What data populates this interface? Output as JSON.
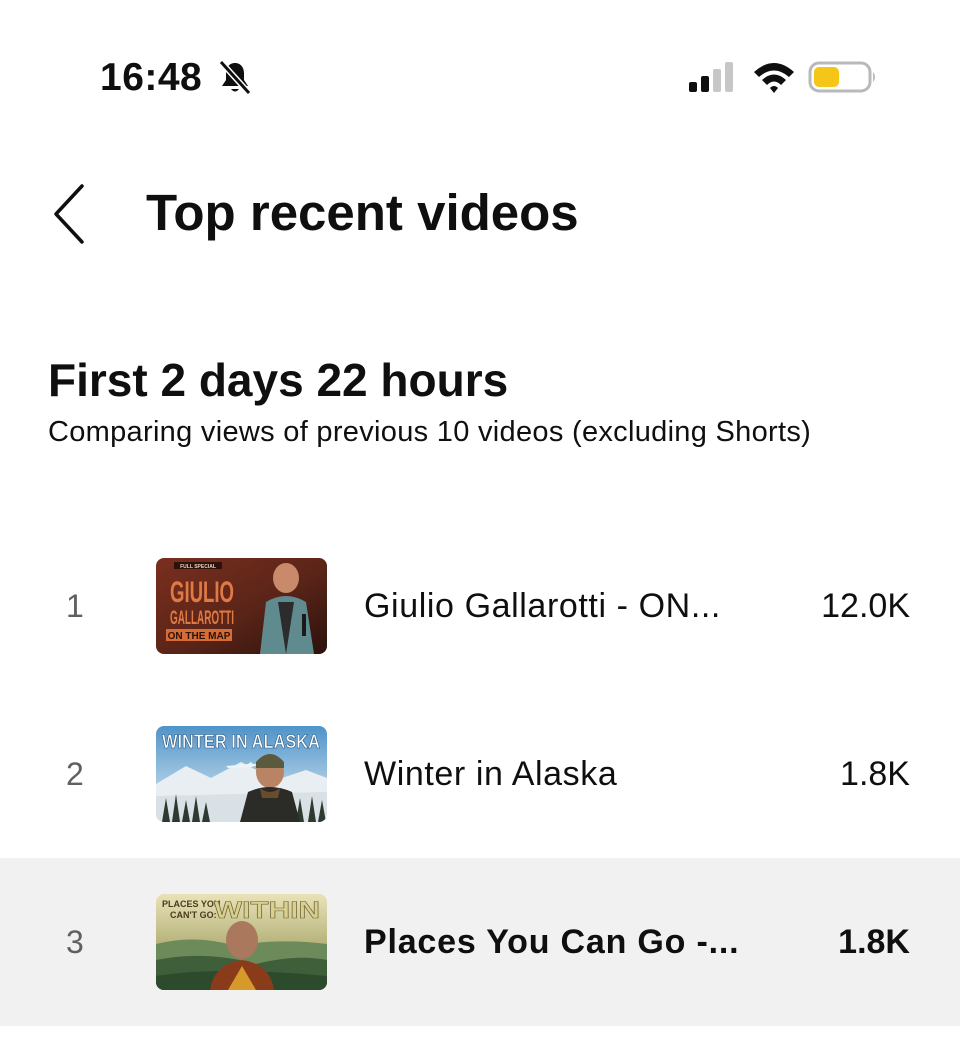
{
  "status_bar": {
    "time": "16:48",
    "icons": [
      "bell-off-icon",
      "cellular-signal-icon",
      "wifi-icon",
      "battery-low-power-icon"
    ],
    "battery_color": "#f5c518"
  },
  "header": {
    "title": "Top recent videos",
    "back_icon": "chevron-left-icon"
  },
  "section": {
    "title": "First 2 days 22 hours",
    "subtitle": "Comparing views of previous 10 videos (excluding Shorts)"
  },
  "videos": [
    {
      "rank": "1",
      "title": "Giulio Gallarotti - ON...",
      "views": "12.0K",
      "thumbnail": {
        "badge": "FULL SPECIAL",
        "line1": "GIULIO",
        "line2": "GALLAROTTI",
        "line3": "ON THE MAP"
      }
    },
    {
      "rank": "2",
      "title": "Winter in Alaska",
      "views": "1.8K",
      "thumbnail": {
        "line1": "WINTER IN ALASKA"
      }
    },
    {
      "rank": "3",
      "title": "Places You Can Go -...",
      "views": "1.8K",
      "highlighted": true,
      "thumbnail": {
        "line1": "PLACES YOU",
        "line2": "CAN'T GO:",
        "line3": "WITHIN"
      }
    }
  ],
  "colors": {
    "highlight_row": "#f1f1f1",
    "rank_text": "#606060"
  }
}
